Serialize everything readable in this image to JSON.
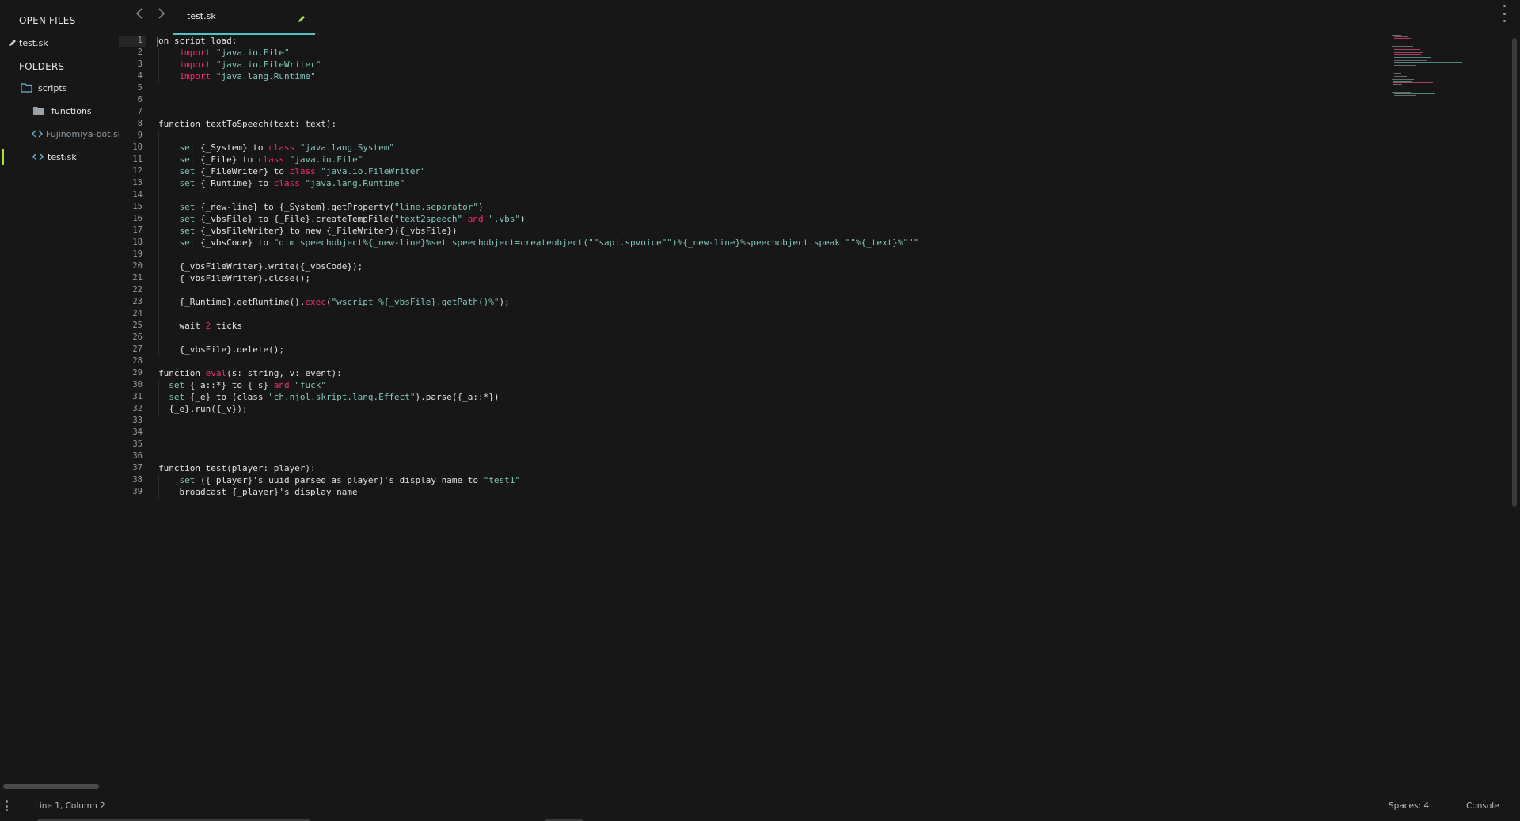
{
  "sidebar": {
    "open_files_label": "OPEN FILES",
    "open_files": [
      {
        "name": "test.sk",
        "modified": true
      }
    ],
    "folders_label": "FOLDERS",
    "tree": {
      "folder": "scripts",
      "items": [
        {
          "name": "functions",
          "type": "folder"
        },
        {
          "name": "Fujinomiya-bot.sk",
          "type": "file"
        },
        {
          "name": "test.sk",
          "type": "file",
          "active": true
        }
      ]
    }
  },
  "tabs": [
    {
      "label": "test.sk",
      "modified": true
    }
  ],
  "editor": {
    "lines": [
      "on script load:",
      "    import \"java.io.File\"",
      "    import \"java.io.FileWriter\"",
      "    import \"java.lang.Runtime\"",
      "",
      "",
      "",
      "function textToSpeech(text: text):",
      "",
      "    set {_System} to class \"java.lang.System\"",
      "    set {_File} to class \"java.io.File\"",
      "    set {_FileWriter} to class \"java.io.FileWriter\"",
      "    set {_Runtime} to class \"java.lang.Runtime\"",
      "",
      "    set {_new-line} to {_System}.getProperty(\"line.separator\")",
      "    set {_vbsFile} to {_File}.createTempFile(\"text2speech\" and \".vbs\")",
      "    set {_vbsFileWriter} to new {_FileWriter}({_vbsFile})",
      "    set {_vbsCode} to \"dim speechobject%{_new-line}%set speechobject=createobject(\"\"sapi.spvoice\"\")%{_new-line}%speechobject.speak \"\"%{_text}%\"\"\"",
      "",
      "    {_vbsFileWriter}.write({_vbsCode});",
      "    {_vbsFileWriter}.close();",
      "",
      "    {_Runtime}.getRuntime().exec(\"wscript %{_vbsFile}.getPath()%\");",
      "",
      "    wait 2 ticks",
      "",
      "    {_vbsFile}.delete();",
      "",
      "function eval(s: string, v: event):",
      "  set {_a::*} to {_s} and \"fuck\"",
      "  set {_e} to (class \"ch.njol.skript.lang.Effect\").parse({_a::*})",
      "  {_e}.run({_v});",
      "",
      "",
      "",
      "",
      "function test(player: player):",
      "    set ({_player}'s uuid parsed as player)'s display name to \"test1\"",
      "    broadcast {_player}'s display name"
    ]
  },
  "status": {
    "position": "Line 1, Column 2",
    "spaces": "Spaces: 4",
    "console": "Console"
  },
  "colors": {
    "background": "#171717",
    "keyword": "#f92672",
    "string": "#7ec9bd",
    "accent": "#4fc1c7",
    "active": "#a6e22e"
  }
}
